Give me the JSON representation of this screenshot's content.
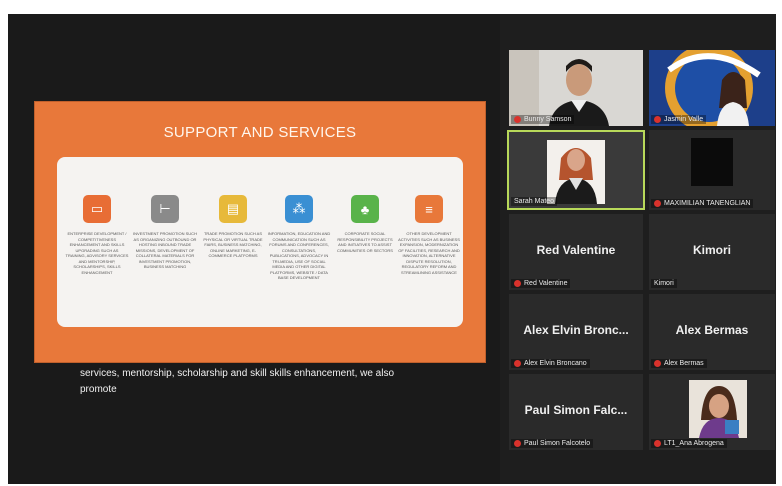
{
  "slide": {
    "title": "SUPPORT AND SERVICES",
    "cards": [
      {
        "icon": "tools-icon",
        "color": "#e86d35",
        "text": "ENTERPRISE DEVELOPMENT / COMPETITIVENESS ENHANCEMENT AND SKILLS UPGRADING SUCH AS TRAINING, ADVISORY SERVICES AND MENTORSHIP, SCHOLARSHIPS, SKILLS ENHANCEMENT"
      },
      {
        "icon": "flow-icon",
        "color": "#8a8a8a",
        "text": "INVESTMENT PROMOTION SUCH AS ORGANIZING OUTBOUND OR HOSTING INBOUND TRADE MISSIONS, DEVELOPMENT OF COLLATERAL MATERIALS FOR INVESTMENT PROMOTION, BUSINESS MATCHING"
      },
      {
        "icon": "store-icon",
        "color": "#e7b93a",
        "text": "TRADE PROMOTION SUCH AS PHYSICAL OR VIRTUAL TRADE FAIRS, BUSINESS MATCHING, ONLINE MARKETING, E-COMMERCE PLATFORMS"
      },
      {
        "icon": "people-icon",
        "color": "#3a8fd3",
        "text": "INFORMATION, EDUCATION AND COMMUNICATION SUCH AS FORUMS AND CONFERENCES, CONSULTATIONS, PUBLICATIONS, ADVOCACY IN TRI-MEDIA, USE OF SOCIAL MEDIA AND OTHER DIGITAL PLATFORMS, WEBSITE / DATA BASE DEVELOPMENT"
      },
      {
        "icon": "tree-icon",
        "color": "#59b34a",
        "text": "CORPORATE SOCIAL RESPONSIBILITY PROJECTS AND INITIATIVES TO ASSIST COMMUNITIES OR SECTORS"
      },
      {
        "icon": "database-icon",
        "color": "#e8783a",
        "text": "OTHER DEVELOPMENT ACTIVITIES SUCH AS BUSINESS EXPANSION, MODERNIZATION OF FACILITIES, RESEARCH AND INNOVATION, ALTERNATIVE DISPUTE RESOLUTION, REGULATORY REFORM AND STREAMLINING ASSISTANCE"
      }
    ]
  },
  "caption": "services, mentorship, scholarship and skill skills enhancement, we also promote",
  "participants": [
    {
      "label": "Bunny Samson",
      "muted": true,
      "video": true
    },
    {
      "label": "Jasmin Valle",
      "muted": true,
      "video": true
    },
    {
      "label": "Sarah Mateo",
      "muted": false,
      "video": true,
      "active": true
    },
    {
      "label": "MAXIMILIAN TANENGLIAN",
      "muted": true,
      "video": true
    },
    {
      "label": "Red Valentine",
      "display": "Red Valentine",
      "muted": true,
      "video": false
    },
    {
      "label": "Kimori",
      "display": "Kimori",
      "muted": false,
      "video": false
    },
    {
      "label": "Alex Elvin Broncano",
      "display": "Alex Elvin Bronc...",
      "muted": true,
      "video": false
    },
    {
      "label": "Alex Bermas",
      "display": "Alex Bermas",
      "muted": true,
      "video": false
    },
    {
      "label": "Paul Simon Falcotelo",
      "display": "Paul Simon Falc...",
      "muted": true,
      "video": false
    },
    {
      "label": "LT1_Ana Abrogena",
      "muted": true,
      "video": true
    }
  ],
  "colors": {
    "accent_active": "#b8d95a",
    "mute_red": "#d9322c",
    "slide_orange": "#e8783a"
  }
}
